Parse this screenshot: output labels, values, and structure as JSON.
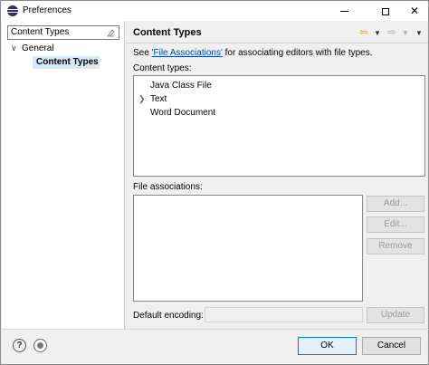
{
  "window": {
    "title": "Preferences"
  },
  "sidebar": {
    "filter_value": "Content Types",
    "tree": [
      {
        "label": "General",
        "expanded": true
      },
      {
        "label": "Content Types",
        "selected": true
      }
    ]
  },
  "page": {
    "title": "Content Types",
    "description_prefix": "See ",
    "description_link": "'File Associations'",
    "description_suffix": " for associating editors with file types.",
    "content_types_label": "Content types:",
    "content_types": [
      {
        "label": "Java Class File",
        "expandable": false
      },
      {
        "label": "Text",
        "expandable": true
      },
      {
        "label": "Word Document",
        "expandable": false
      }
    ],
    "file_associations_label": "File associations:",
    "buttons": {
      "add": "Add...",
      "edit": "Edit...",
      "remove": "Remove",
      "update": "Update"
    },
    "default_encoding_label": "Default encoding:",
    "default_encoding_value": ""
  },
  "footer": {
    "ok": "OK",
    "cancel": "Cancel"
  },
  "colors": {
    "selection": "#d9ebf9",
    "link": "#0645ad",
    "default_button_border": "#0078d7"
  }
}
